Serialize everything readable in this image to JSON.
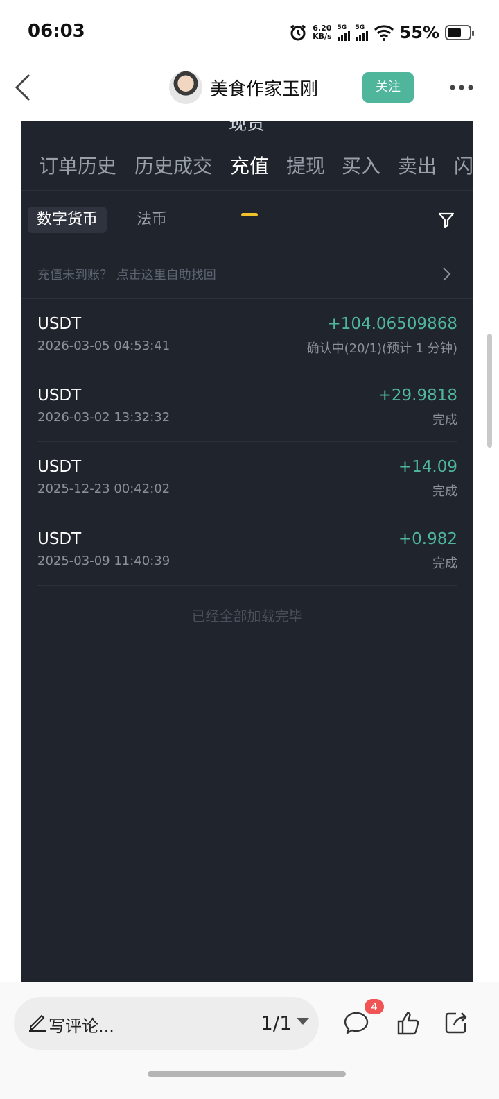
{
  "status_bar": {
    "time": "06:03",
    "net_speed": "6.20",
    "net_unit": "KB/s",
    "sim1": "5G",
    "sim2": "5G",
    "battery": "55%"
  },
  "header": {
    "author": "美食作家玉刚",
    "follow_label": "关注"
  },
  "panel": {
    "cut_title": "现货",
    "tabs": [
      "订单历史",
      "历史成交",
      "充值",
      "提现",
      "买入",
      "卖出",
      "闪"
    ],
    "active_tab": "充值",
    "subtabs": [
      "数字货币",
      "法币"
    ],
    "notice": "充值未到账？ 点击这里自助找回",
    "records": [
      {
        "coin": "USDT",
        "date": "2026-03-05 04:53:41",
        "amount": "+104.06509868",
        "status": "确认中(20/1)(预计 1 分钟)"
      },
      {
        "coin": "USDT",
        "date": "2026-03-02 13:32:32",
        "amount": "+29.9818",
        "status": "完成"
      },
      {
        "coin": "USDT",
        "date": "2025-12-23 00:42:02",
        "amount": "+14.09",
        "status": "完成"
      },
      {
        "coin": "USDT",
        "date": "2025-03-09 11:40:39",
        "amount": "+0.982",
        "status": "完成"
      }
    ],
    "end_text": "已经全部加载完毕"
  },
  "bottom": {
    "comment_placeholder": "写评论...",
    "page_indicator": "1/1",
    "comment_count": "4"
  },
  "colors": {
    "panel_bg": "#20242d",
    "accent_green": "#4fb69c",
    "tab_indicator": "#f0c12b",
    "badge_red": "#f05454"
  }
}
